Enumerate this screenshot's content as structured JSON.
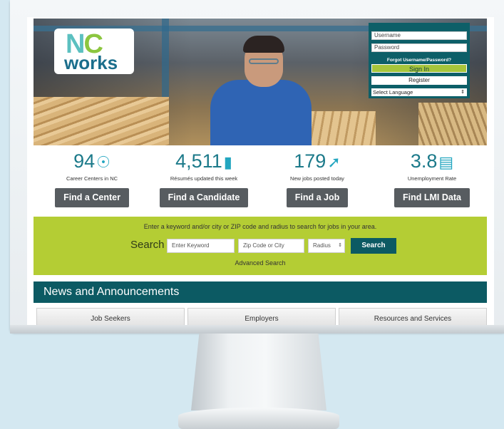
{
  "logo": {
    "line1_n": "N",
    "line1_c": "C",
    "line2": "works"
  },
  "login": {
    "username_placeholder": "Username",
    "password_placeholder": "Password",
    "forgot": "Forgot Username/Password?",
    "signin": "Sign In",
    "register": "Register",
    "language": "Select Language"
  },
  "stats": [
    {
      "value": "94",
      "icon": "target-icon",
      "description": "Career Centers in NC",
      "button": "Find a Center"
    },
    {
      "value": "4,511",
      "icon": "document-icon",
      "description": "Résumés updated this week",
      "button": "Find a Candidate"
    },
    {
      "value": "179",
      "icon": "pin-icon",
      "description": "New jobs posted today",
      "button": "Find a Job"
    },
    {
      "value": "3.8",
      "icon": "briefcase-icon",
      "description": "Unemployment Rate",
      "button": "Find LMI Data"
    }
  ],
  "search": {
    "prompt": "Enter a keyword and/or city or ZIP code and radius to search for jobs in your area.",
    "label": "Search",
    "keyword_placeholder": "Enter Keyword",
    "zip_placeholder": "Zip Code or City",
    "radius": "Radius",
    "button": "Search",
    "advanced": "Advanced Search"
  },
  "news": {
    "title": "News and Announcements",
    "tabs": [
      "Job Seekers",
      "Employers",
      "Resources and Services"
    ]
  },
  "colors": {
    "accent_teal": "#0c5a63",
    "lime": "#b4cd34",
    "stat_blue": "#1c7a8a"
  }
}
